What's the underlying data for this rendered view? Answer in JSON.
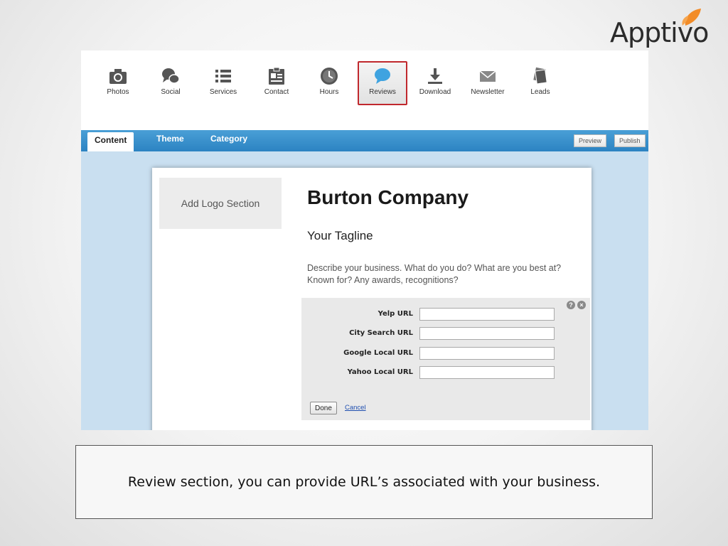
{
  "brand": {
    "name": "Apptivo",
    "leaf_color": "#f28c28"
  },
  "toolbar": {
    "items": [
      {
        "label": "Photos",
        "icon": "camera-icon"
      },
      {
        "label": "Social",
        "icon": "chat-bubbles-icon"
      },
      {
        "label": "Services",
        "icon": "list-icon"
      },
      {
        "label": "Contact",
        "icon": "contact-card-icon"
      },
      {
        "label": "Hours",
        "icon": "clock-icon"
      },
      {
        "label": "Reviews",
        "icon": "speech-bubble-icon"
      },
      {
        "label": "Download",
        "icon": "download-icon"
      },
      {
        "label": "Newsletter",
        "icon": "envelope-icon"
      },
      {
        "label": "Leads",
        "icon": "cards-icon"
      }
    ],
    "active": "Reviews"
  },
  "tabs": {
    "items": [
      "Content",
      "Theme",
      "Category"
    ],
    "active": "Content",
    "preview_label": "Preview",
    "publish_label": "Publish"
  },
  "page": {
    "logo_placeholder": "Add Logo Section",
    "company_name": "Burton Company",
    "tagline": "Your Tagline",
    "description": "Describe your business. What do you do? What are you best at? Known for? Any awards, recognitions?"
  },
  "reviews": {
    "fields": [
      {
        "label": "Yelp URL",
        "value": ""
      },
      {
        "label": "City Search URL",
        "value": ""
      },
      {
        "label": "Google Local URL",
        "value": ""
      },
      {
        "label": "Yahoo Local URL",
        "value": ""
      }
    ],
    "done_label": "Done",
    "cancel_label": "Cancel",
    "help_glyph": "?",
    "close_glyph": "×"
  },
  "caption": "Review section, you can provide  URL’s associated with your business.",
  "colors": {
    "tab_blue": "#2c83c2",
    "highlight_red": "#c0282d",
    "reviews_blue": "#3fa3e0",
    "icon_gray": "#555555"
  }
}
